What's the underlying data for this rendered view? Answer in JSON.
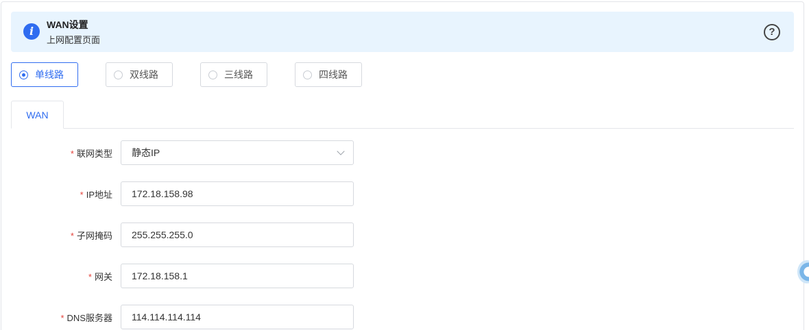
{
  "banner": {
    "icon": "info-icon",
    "title": "WAN设置",
    "subtitle": "上网配置页面",
    "help_icon": "help-circle-icon",
    "info_glyph": "i",
    "help_glyph": "?"
  },
  "modes": [
    {
      "label": "单线路",
      "selected": true
    },
    {
      "label": "双线路",
      "selected": false
    },
    {
      "label": "三线路",
      "selected": false
    },
    {
      "label": "四线路",
      "selected": false
    }
  ],
  "tabs": [
    {
      "label": "WAN",
      "active": true
    }
  ],
  "form": {
    "required_mark": "*",
    "fields": [
      {
        "label": "联网类型",
        "value": "静态IP",
        "type": "select"
      },
      {
        "label": "IP地址",
        "value": "172.18.158.98",
        "type": "input"
      },
      {
        "label": "子网掩码",
        "value": "255.255.255.0",
        "type": "input"
      },
      {
        "label": "网关",
        "value": "172.18.158.1",
        "type": "input"
      },
      {
        "label": "DNS服务器",
        "value": "114.114.114.114",
        "type": "input"
      }
    ]
  },
  "colors": {
    "accent": "#2f6cf0",
    "banner_bg": "#e8f4fe",
    "required": "#e5453d",
    "border": "#d6d9de"
  }
}
